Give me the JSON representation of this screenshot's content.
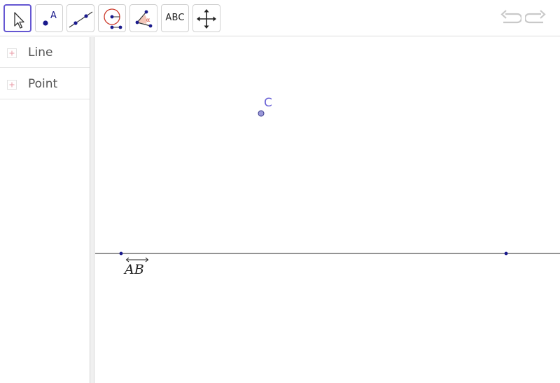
{
  "toolbar": {
    "tools": [
      {
        "name": "Move",
        "icon": "arrow-cursor-icon"
      },
      {
        "name": "Point",
        "icon": "point-icon",
        "glyph": "A"
      },
      {
        "name": "Line",
        "icon": "line-through-points-icon"
      },
      {
        "name": "Circle with Center",
        "icon": "circle-center-point-icon"
      },
      {
        "name": "Angle",
        "icon": "angle-icon",
        "glyph": "α"
      },
      {
        "name": "Text",
        "icon": "text-icon",
        "glyph": "ABC"
      },
      {
        "name": "Move Graphics View",
        "icon": "move-graphics-icon"
      }
    ],
    "undo_icon": "undo-icon",
    "redo_icon": "redo-icon"
  },
  "algebra": {
    "items": [
      {
        "label": "Line",
        "icon": "expand-plus-icon"
      },
      {
        "label": "Point",
        "icon": "expand-plus-icon"
      }
    ]
  },
  "graphics": {
    "line_label": "AB",
    "point_c_label": "C"
  },
  "colors": {
    "accent": "#6557d2",
    "point": "#1a1a8c",
    "point_c_fill": "#9a98d8",
    "label_c": "#6b63d6",
    "circle_red": "#cc3a2a"
  }
}
